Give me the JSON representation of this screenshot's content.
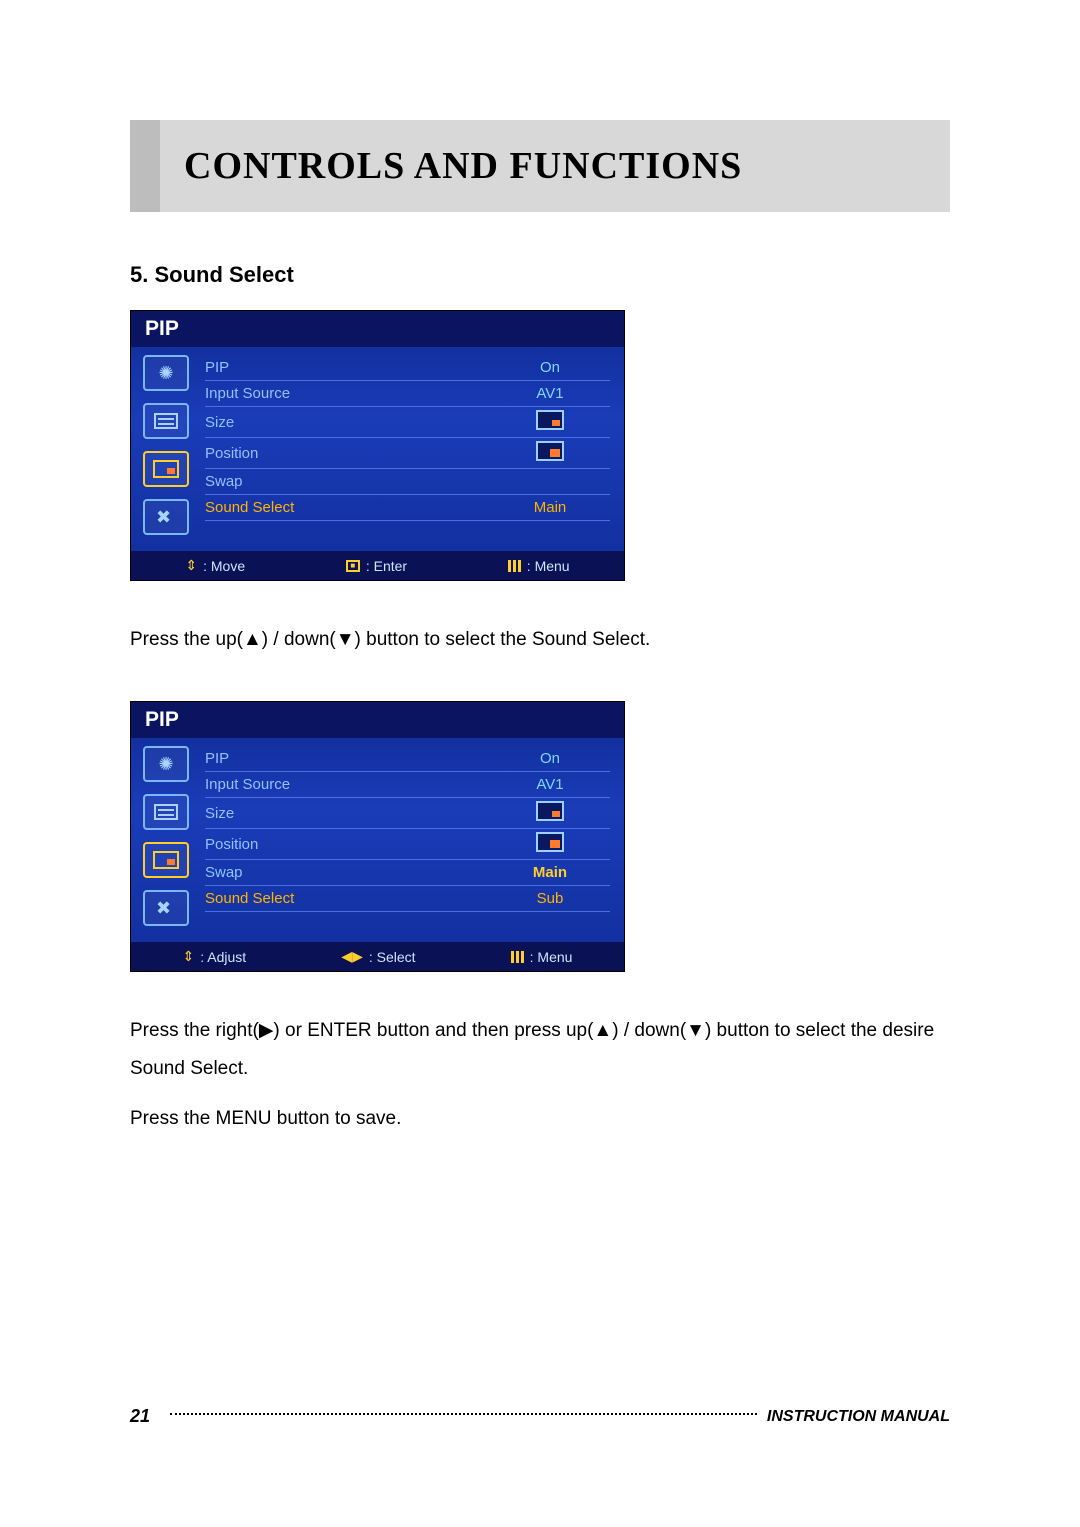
{
  "page": {
    "title": "CONTROLS AND FUNCTIONS",
    "section_heading": "5. Sound Select",
    "text1": "Press the up(▲) / down(▼) button to select the Sound Select.",
    "text2": "Press the right(▶) or ENTER button and then press up(▲) / down(▼) button to select the desire Sound Select.",
    "text3": "Press the MENU button to save.",
    "page_number": "21",
    "footer_label": "INSTRUCTION MANUAL"
  },
  "osd1": {
    "title": "PIP",
    "rows": [
      {
        "label": "PIP",
        "value": "On"
      },
      {
        "label": "Input Source",
        "value": "AV1"
      },
      {
        "label": "Size",
        "value_icon": "small-inner"
      },
      {
        "label": "Position",
        "value_icon": "corner"
      },
      {
        "label": "Swap",
        "value": ""
      },
      {
        "label": "Sound Select",
        "value": "Main",
        "selected": true
      }
    ],
    "hints": {
      "left": ": Move",
      "center": ": Enter",
      "right": ": Menu"
    }
  },
  "osd2": {
    "title": "PIP",
    "rows": [
      {
        "label": "PIP",
        "value": "On"
      },
      {
        "label": "Input Source",
        "value": "AV1"
      },
      {
        "label": "Size",
        "value_icon": "small-inner"
      },
      {
        "label": "Position",
        "value_icon": "corner"
      },
      {
        "label": "Swap",
        "value": "Main",
        "highlight": true
      },
      {
        "label": "Sound Select",
        "value": "Sub",
        "selected": true
      }
    ],
    "hints": {
      "left": ": Adjust",
      "center": ": Select",
      "right": ": Menu"
    }
  },
  "icons": {
    "arrows_updown": "⇕",
    "arrows_leftright": "◀▶"
  }
}
